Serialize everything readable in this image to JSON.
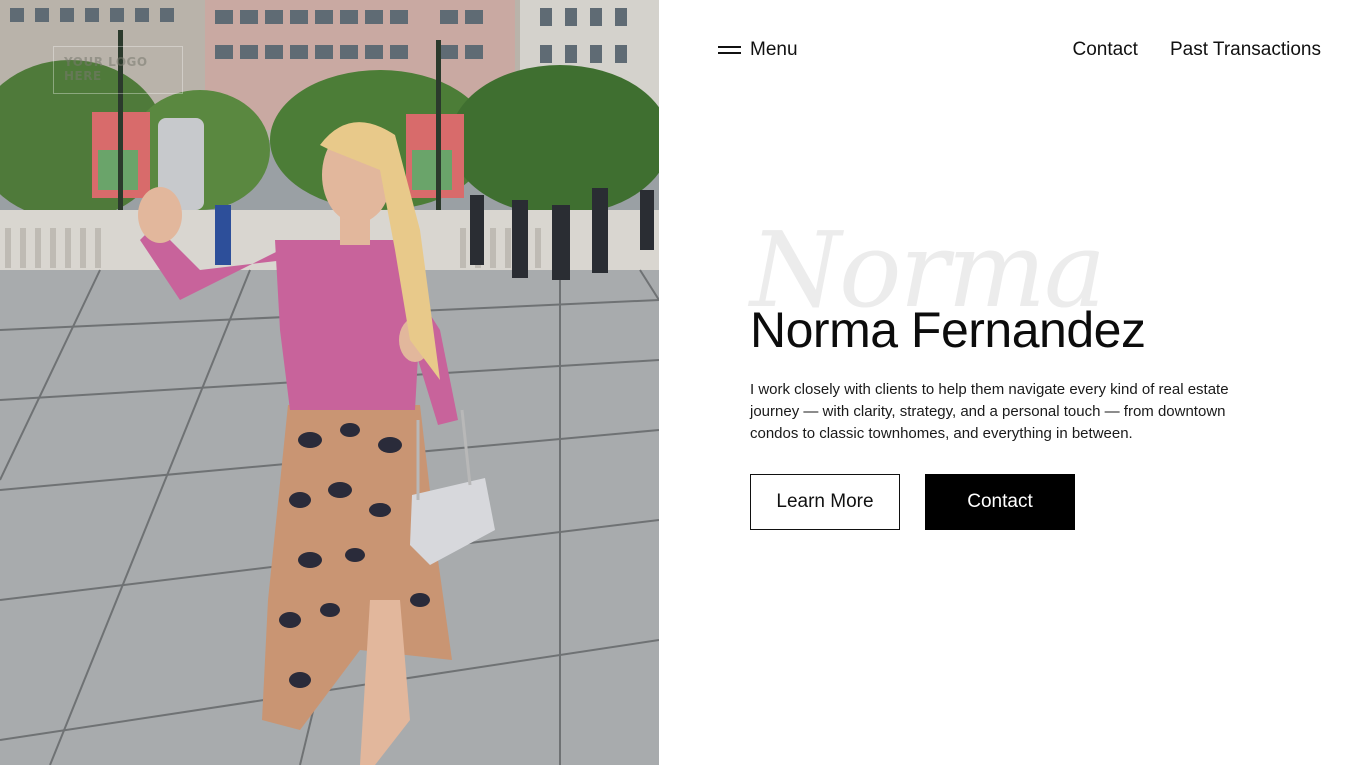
{
  "brand": {
    "logo_text": "YOUR LOGO HERE"
  },
  "nav": {
    "menu_label": "Menu",
    "links": [
      "Contact",
      "Past Transactions"
    ]
  },
  "hero": {
    "script_text": "Norma",
    "title": "Norma Fernandez",
    "description": "I work closely with clients to help them navigate every kind of real estate journey — with clarity, strategy, and a personal touch — from downtown condos to classic townhomes, and everything in between.",
    "primary_button": "Learn More",
    "secondary_button": "Contact"
  },
  "photo": {
    "alt": "Woman taking a selfie on a city plaza"
  },
  "colors": {
    "background": "#ffffff",
    "text": "#111111",
    "button_solid": "#000000",
    "script_watermark": "#ececec"
  },
  "icons": {
    "menu": "hamburger-icon"
  }
}
